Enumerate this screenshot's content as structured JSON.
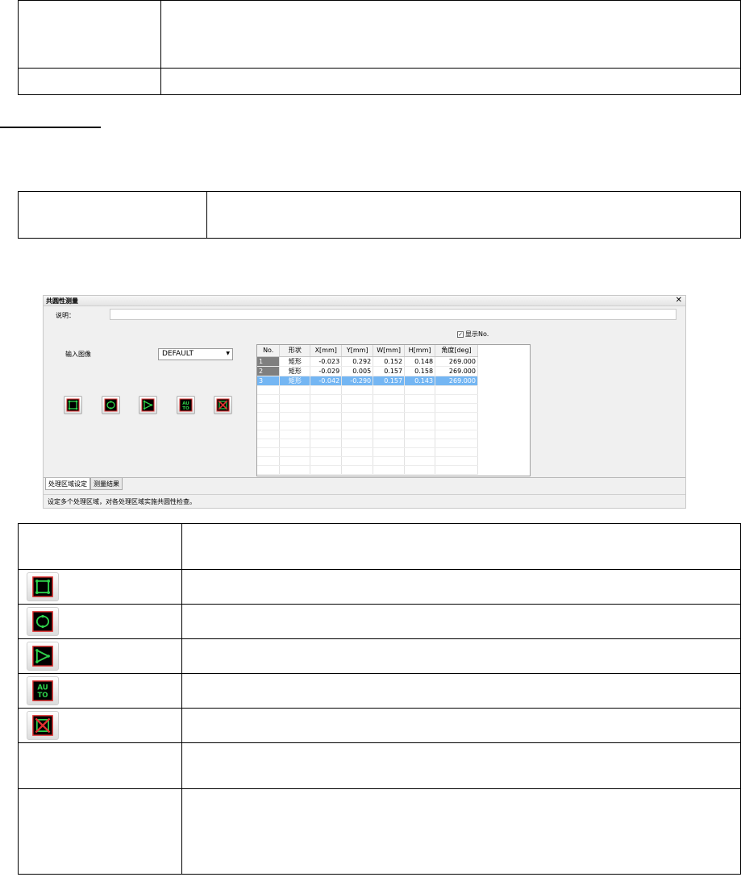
{
  "dialog": {
    "title": "共圆性测量",
    "close_glyph": "✕",
    "description_label": "说明：",
    "description_value": "",
    "input_image_label": "输入图像",
    "input_image_value": "DEFAULT",
    "show_no_label": "显示No.",
    "show_no_checked": true,
    "tools": [
      {
        "name": "rectangle-region-icon"
      },
      {
        "name": "circle-region-icon"
      },
      {
        "name": "polygon-region-icon"
      },
      {
        "name": "auto-icon",
        "text": "AU TO"
      },
      {
        "name": "delete-region-icon"
      }
    ],
    "grid": {
      "headers": [
        "No.",
        "形状",
        "X[mm]",
        "Y[mm]",
        "W[mm]",
        "H[mm]",
        "角度[deg]"
      ],
      "rows": [
        [
          "1",
          "矩形",
          "-0.023",
          "0.292",
          "0.152",
          "0.148",
          "269.000"
        ],
        [
          "2",
          "矩形",
          "-0.029",
          "0.005",
          "0.157",
          "0.158",
          "269.000"
        ],
        [
          "3",
          "矩形",
          "-0.042",
          "-0.290",
          "0.157",
          "0.143",
          "269.000"
        ]
      ],
      "selected_row": 3
    },
    "tabs": [
      "处理区域设定",
      "测量结果"
    ],
    "active_tab": 0,
    "status_text": "设定多个处理区域，对各处理区域实施共圆性检查。"
  },
  "colors": {
    "icon_bg": "#000000",
    "icon_green": "#2fd14a",
    "icon_red": "#e03030",
    "selection": "#74b6f3"
  }
}
